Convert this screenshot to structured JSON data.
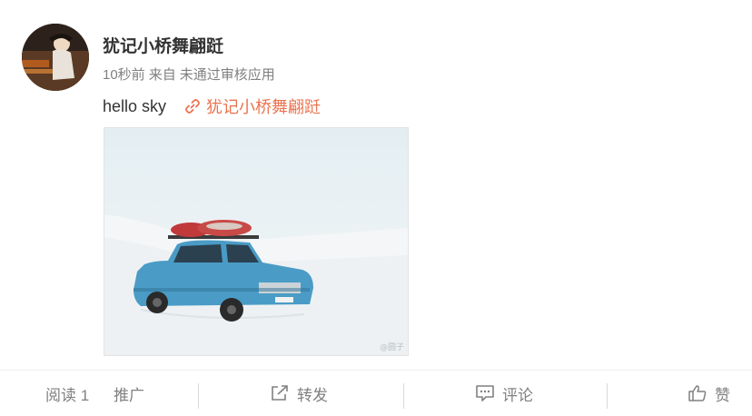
{
  "post": {
    "author": "犹记小桥舞翩跹",
    "time": "10秒前",
    "source_prefix": "来自",
    "source": "未通过审核应用",
    "text": "hello sky",
    "link_label": "犹记小桥舞翩跹",
    "watermark": "@圆子"
  },
  "footer": {
    "read": "阅读 1",
    "promote": "推广",
    "repost": "转发",
    "comment": "评论",
    "like": "赞"
  },
  "colors": {
    "link": "#eb7350",
    "muted": "#808080",
    "text": "#333333"
  },
  "icons": [
    "link-icon",
    "repost-icon",
    "comment-icon",
    "like-icon"
  ]
}
